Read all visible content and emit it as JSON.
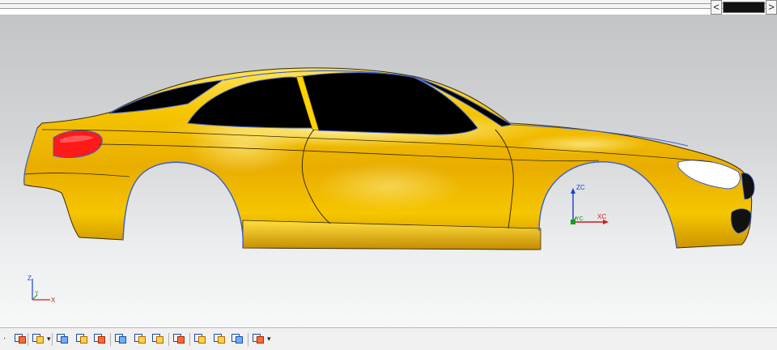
{
  "window": {
    "scroll_left_glyph": "<",
    "scroll_right_glyph": ">"
  },
  "viewport": {
    "background_top": "#c2c4c6",
    "background_bottom": "#f7f8f8",
    "car_color": "#f2b800",
    "window_color": "#000000",
    "taillight_color": "#ff1a1a",
    "edge_color": "#3d5fd0",
    "wcs_triad": {
      "x_label": "X",
      "y_label": "Y",
      "z_label": "Z"
    },
    "work_triad": {
      "x_label": "XC",
      "y_label": "YC",
      "z_label": "ZC"
    }
  },
  "toolbar": {
    "icons": [
      {
        "name": "menu-overflow-icon"
      },
      {
        "name": "view-cube-icon"
      },
      {
        "name": "add-component-icon"
      },
      {
        "name": "move-component-icon"
      },
      {
        "name": "assembly-constraints-icon"
      },
      {
        "name": "reposition-icon"
      },
      {
        "name": "mirror-assembly-icon"
      },
      {
        "name": "pattern-component-icon"
      },
      {
        "name": "replace-component-icon"
      },
      {
        "name": "wave-geometry-icon"
      },
      {
        "name": "link-icon"
      },
      {
        "name": "sketch-tool-icon"
      },
      {
        "name": "inspect-icon"
      },
      {
        "name": "exploded-view-icon"
      }
    ]
  }
}
